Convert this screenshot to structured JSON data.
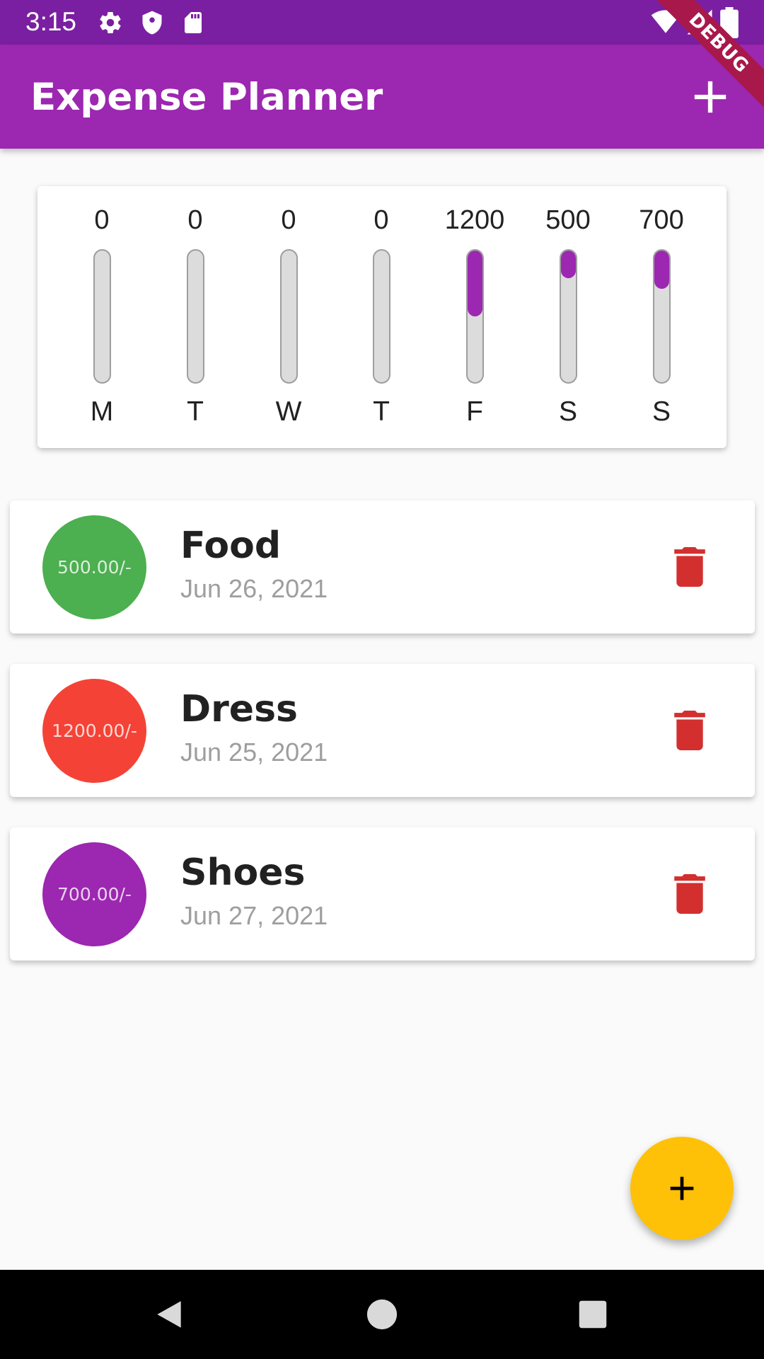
{
  "status_bar": {
    "time": "3:15",
    "icons": [
      "settings-icon",
      "shield-icon",
      "sd-card-icon",
      "wifi-icon",
      "signal-icon",
      "battery-icon"
    ]
  },
  "debug_banner": "DEBUG",
  "app_bar": {
    "title": "Expense Planner",
    "add_icon": "plus-icon"
  },
  "chart": {
    "fill_color": "#9c27b0",
    "days": [
      {
        "label": "M",
        "amount": "0",
        "fraction": 0
      },
      {
        "label": "T",
        "amount": "0",
        "fraction": 0
      },
      {
        "label": "W",
        "amount": "0",
        "fraction": 0
      },
      {
        "label": "T",
        "amount": "0",
        "fraction": 0
      },
      {
        "label": "F",
        "amount": "1200",
        "fraction": 0.5
      },
      {
        "label": "S",
        "amount": "500",
        "fraction": 0.208
      },
      {
        "label": "S",
        "amount": "700",
        "fraction": 0.292
      }
    ]
  },
  "expenses": [
    {
      "amount": "500.00/-",
      "title": "Food",
      "date": "Jun 26, 2021",
      "color": "#4caf50",
      "delete_icon": "trash-icon"
    },
    {
      "amount": "1200.00/-",
      "title": "Dress",
      "date": "Jun 25, 2021",
      "color": "#f44336",
      "delete_icon": "trash-icon"
    },
    {
      "amount": "700.00/-",
      "title": "Shoes",
      "date": "Jun 27, 2021",
      "color": "#9c27b0",
      "delete_icon": "trash-icon"
    }
  ],
  "fab": {
    "icon": "plus-icon",
    "color": "#ffc107"
  },
  "nav": [
    "back-icon",
    "home-icon",
    "recents-icon"
  ],
  "colors": {
    "primary": "#9c27b0",
    "status_bar": "#7b1fa2",
    "delete": "#d32f2f"
  }
}
